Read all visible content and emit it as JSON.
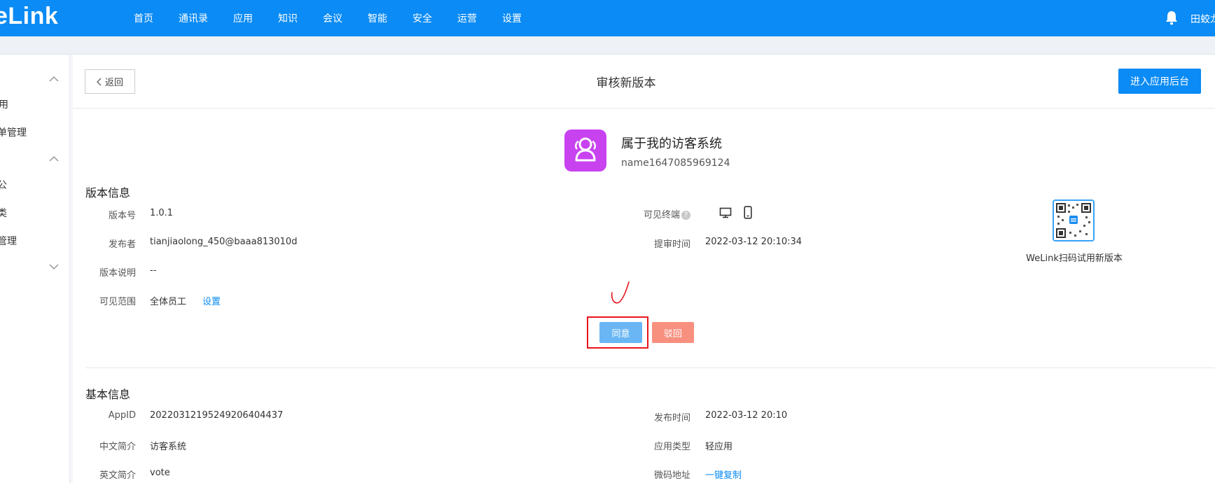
{
  "colors": {
    "brand": "#0a8bf5",
    "agree": "#6ab6f5",
    "reject": "#f89080",
    "highlight": "#e8141b",
    "app_icon": "#c842f0"
  },
  "topbar": {
    "logo": "eLink",
    "nav": [
      "首页",
      "通讯录",
      "应用",
      "知识",
      "会议",
      "智能",
      "安全",
      "运营",
      "设置"
    ],
    "user": "田蛟龙"
  },
  "sidebar": {
    "items": [
      "用",
      "单管理",
      "公",
      "类",
      "管理"
    ]
  },
  "header": {
    "back_label": "返回",
    "title": "审核新版本",
    "enter_label": "进入应用后台"
  },
  "app": {
    "name": "属于我的访客系统",
    "identifier": "name1647085969124",
    "icon": "users-icon"
  },
  "version_info": {
    "title": "版本信息",
    "version_label": "版本号",
    "version_value": "1.0.1",
    "publisher_label": "发布者",
    "publisher_value": "tianjiaolong_450@baaa813010d",
    "desc_label": "版本说明",
    "desc_value": "--",
    "scope_label": "可见范围",
    "scope_value": "全体员工",
    "scope_link": "设置",
    "terminal_label": "可见终端",
    "terminal_help": "?",
    "terminal_icons": [
      "desktop-icon",
      "mobile-icon"
    ],
    "submit_time_label": "提审时间",
    "submit_time_value": "2022-03-12 20:10:34",
    "qr_label": "WeLink扫码试用新版本"
  },
  "actions": {
    "agree_label": "同意",
    "reject_label": "驳回"
  },
  "basic_info": {
    "title": "基本信息",
    "appid_label": "AppID",
    "appid_value": "20220312195249206404437",
    "cn_desc_label": "中文简介",
    "cn_desc_value": "访客系统",
    "en_desc_label": "英文简介",
    "en_desc_value": "vote",
    "publish_time_label": "发布时间",
    "publish_time_value": "2022-03-12 20:10",
    "app_type_label": "应用类型",
    "app_type_value": "轻应用",
    "micro_code_label": "微码地址",
    "micro_code_link": "一键复制"
  }
}
